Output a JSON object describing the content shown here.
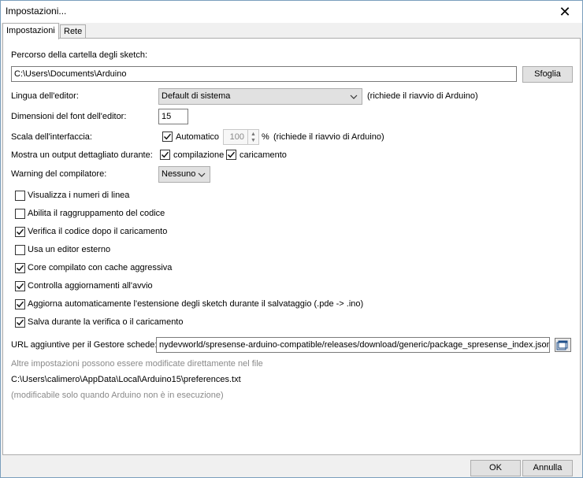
{
  "window": {
    "title": "Impostazioni...",
    "close_glyph": "✕"
  },
  "tabs": [
    {
      "label": "Impostazioni",
      "active": true
    },
    {
      "label": "Rete",
      "active": false
    }
  ],
  "sketchbook": {
    "label": "Percorso della cartella degli sketch:",
    "path": "C:\\Users\\Documents\\Arduino",
    "browse_label": "Sfoglia"
  },
  "language": {
    "label": "Lingua dell'editor:",
    "selected": "Default di sistema",
    "note": "(richiede il riavvio di Arduino)"
  },
  "font_size": {
    "label": "Dimensioni del font dell'editor:",
    "value": "15"
  },
  "scale": {
    "label": "Scala dell'interfaccia:",
    "auto_label": "Automatico",
    "auto_checked": true,
    "value": "100",
    "unit": "%",
    "note": "(richiede il riavvio di Arduino)"
  },
  "verbose": {
    "label": "Mostra un output dettagliato durante:",
    "compile_label": "compilazione",
    "compile_checked": true,
    "upload_label": "caricamento",
    "upload_checked": true
  },
  "warnings": {
    "label": "Warning del compilatore:",
    "selected": "Nessuno"
  },
  "options": [
    {
      "label": "Visualizza i numeri di linea",
      "checked": false
    },
    {
      "label": "Abilita il raggruppamento del codice",
      "checked": false
    },
    {
      "label": "Verifica il codice dopo il caricamento",
      "checked": true
    },
    {
      "label": "Usa un editor esterno",
      "checked": false
    },
    {
      "label": "Core compilato con cache aggressiva",
      "checked": true
    },
    {
      "label": "Controlla aggiornamenti all'avvio",
      "checked": true
    },
    {
      "label": "Aggiorna automaticamente l'estensione degli sketch durante il salvataggio (.pde -> .ino)",
      "checked": true
    },
    {
      "label": "Salva durante la verifica o il caricamento",
      "checked": true
    }
  ],
  "boards_url": {
    "label": "URL aggiuntive per il Gestore schede:",
    "value": "nydevworld/spresense-arduino-compatible/releases/download/generic/package_spresense_index.json",
    "icon": "window-edit-icon"
  },
  "info": {
    "line1": "Altre impostazioni possono essere modificate direttamente nel file",
    "path": "C:\\Users\\calimero\\AppData\\Local\\Arduino15\\preferences.txt",
    "line3": "(modificabile solo quando Arduino non è in esecuzione)"
  },
  "footer": {
    "ok_label": "OK",
    "cancel_label": "Annulla"
  }
}
